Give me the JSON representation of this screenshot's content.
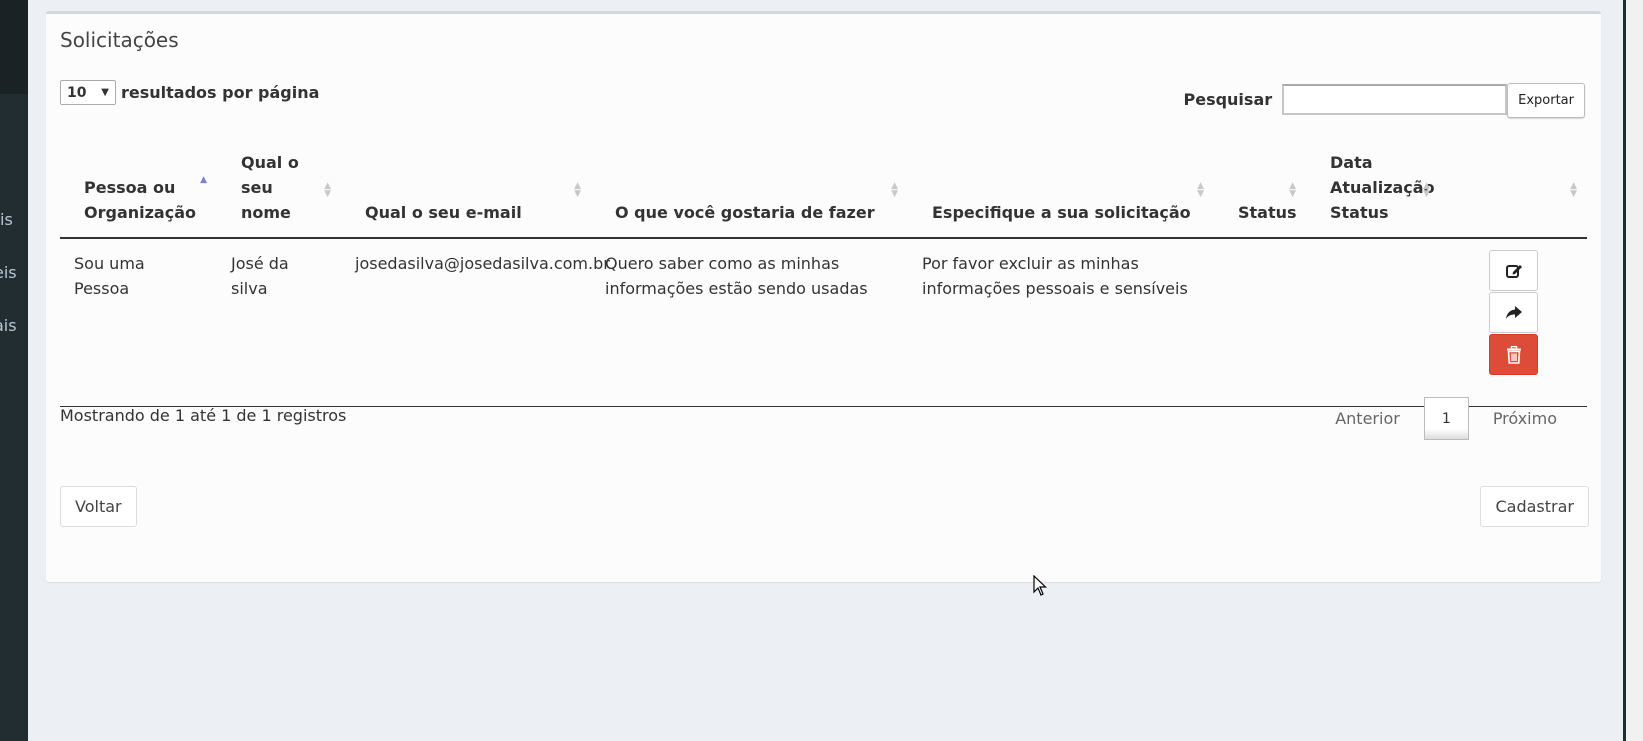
{
  "sidebar": {
    "fragments": [
      "is",
      "eis",
      "ais"
    ]
  },
  "panel": {
    "title": "Solicitações"
  },
  "length": {
    "value": "10",
    "label": "resultados por página"
  },
  "search": {
    "label": "Pesquisar",
    "value": "",
    "export_label": "Exportar"
  },
  "table": {
    "columns": [
      "Pessoa ou Organização",
      "Qual o seu nome",
      "Qual o seu e-mail",
      "O que você gostaria de fazer",
      "Especifique a sua solicitação",
      "Status",
      "Data Atualização Status",
      ""
    ],
    "rows": [
      {
        "tipo": "Sou uma Pessoa",
        "nome": "José da silva",
        "email": "josedasilva@josedasilva.com.br",
        "acao": "Quero saber como as minhas informações estão sendo usadas",
        "solicitacao": "Por favor excluir as minhas informações pessoais e sensíveis",
        "status": "",
        "data": ""
      }
    ]
  },
  "footer": {
    "info": "Mostrando de 1 até 1 de 1 registros",
    "prev": "Anterior",
    "page": "1",
    "next": "Próximo"
  },
  "buttons": {
    "back": "Voltar",
    "submit": "Cadastrar"
  },
  "colors": {
    "danger": "#dd4b39",
    "sidebar": "#222d32",
    "sort_active": "#7b80d1"
  }
}
